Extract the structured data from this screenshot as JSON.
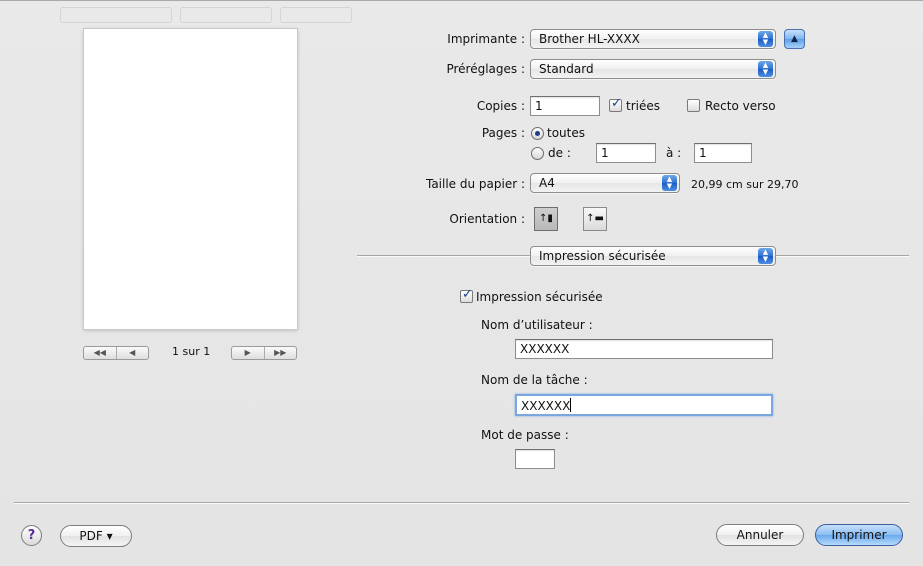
{
  "printer": {
    "label": "Imprimante :",
    "value": "Brother HL-XXXX"
  },
  "presets": {
    "label": "Préréglages :",
    "value": "Standard"
  },
  "copies": {
    "label": "Copies :",
    "value": "1",
    "collate_label": "triées",
    "collate_checked": true,
    "duplex_label": "Recto verso",
    "duplex_checked": false
  },
  "pages": {
    "label": "Pages :",
    "all_label": "toutes",
    "from_label": "de :",
    "from_value": "1",
    "to_label": "à :",
    "to_value": "1",
    "selected": "all"
  },
  "paper": {
    "label": "Taille du papier :",
    "value": "A4",
    "size_text": "20,99 cm sur 29,70"
  },
  "orientation": {
    "label": "Orientation :",
    "selected": "portrait"
  },
  "panel": {
    "value": "Impression sécurisée"
  },
  "secure": {
    "checkbox_label": "Impression sécurisée",
    "checked": true,
    "user_label": "Nom d’utilisateur :",
    "user_value": "XXXXXX",
    "job_label": "Nom de la tâche :",
    "job_value": "XXXXXX",
    "password_label": "Mot de passe :",
    "password_value": ""
  },
  "preview": {
    "page_text": "1 sur 1"
  },
  "footer": {
    "help": "?",
    "pdf_label": "PDF ▾",
    "cancel_label": "Annuler",
    "print_label": "Imprimer"
  },
  "icons": {
    "arrows": "updown-arrows-icon",
    "disclosure": "disclosure-up-icon"
  }
}
